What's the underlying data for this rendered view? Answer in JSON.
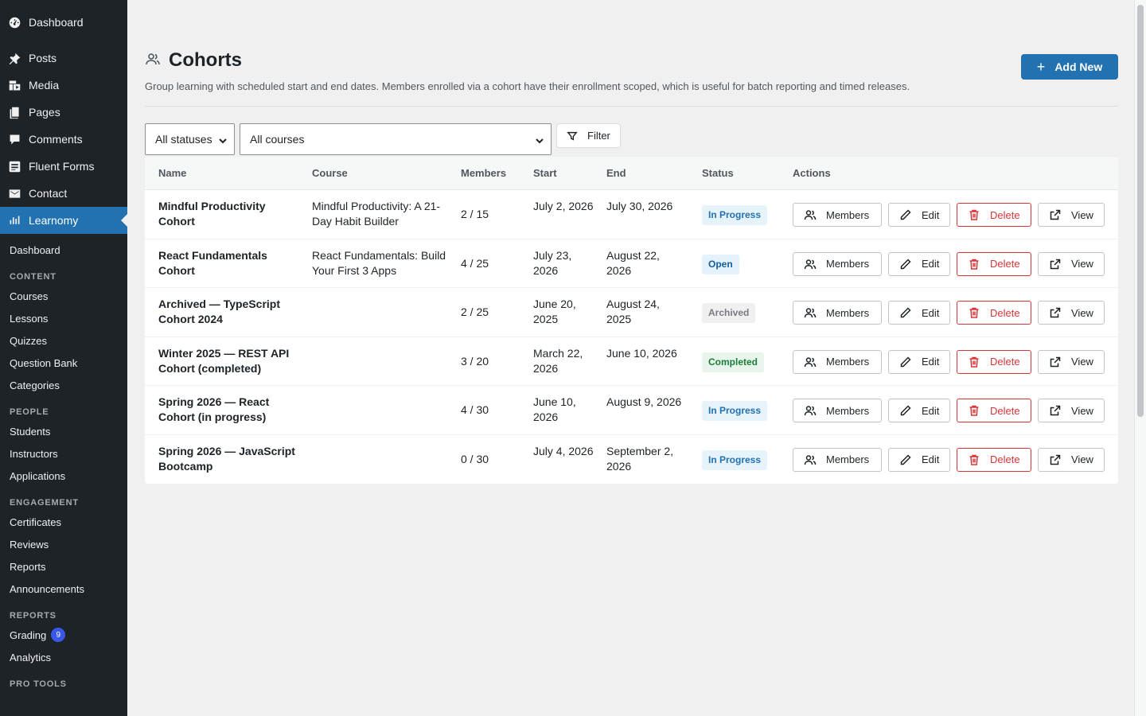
{
  "sidebar": {
    "main_items": [
      {
        "label": "Dashboard",
        "icon": "dashboard-icon"
      },
      {
        "label": "Posts",
        "icon": "pin-icon"
      },
      {
        "label": "Media",
        "icon": "media-icon"
      },
      {
        "label": "Pages",
        "icon": "pages-icon"
      },
      {
        "label": "Comments",
        "icon": "comment-icon"
      },
      {
        "label": "Fluent Forms",
        "icon": "forms-icon"
      },
      {
        "label": "Contact",
        "icon": "mail-icon"
      },
      {
        "label": "Learnomy",
        "icon": "chart-icon",
        "active": true
      }
    ],
    "sub": {
      "dashboard": "Dashboard",
      "content_head": "CONTENT",
      "content": [
        "Courses",
        "Lessons",
        "Quizzes",
        "Question Bank",
        "Categories"
      ],
      "people_head": "PEOPLE",
      "people": [
        "Students",
        "Instructors",
        "Applications"
      ],
      "engagement_head": "ENGAGEMENT",
      "engagement": [
        "Certificates",
        "Reviews",
        "Reports",
        "Announcements"
      ],
      "reports_head": "REPORTS",
      "grading": "Grading",
      "grading_badge": "9",
      "analytics": "Analytics",
      "pro_head": "PRO TOOLS"
    }
  },
  "header": {
    "title": "Cohorts",
    "description": "Group learning with scheduled start and end dates. Members enrolled via a cohort have their enrollment scoped, which is useful for batch reporting and timed releases.",
    "add_new": "Add New"
  },
  "filters": {
    "status": "All statuses",
    "course": "All courses",
    "filter_button": "Filter"
  },
  "table": {
    "columns": [
      "Name",
      "Course",
      "Members",
      "Start",
      "End",
      "Status",
      "Actions"
    ],
    "action_labels": {
      "members": "Members",
      "edit": "Edit",
      "delete": "Delete",
      "view": "View"
    },
    "rows": [
      {
        "name": "Mindful Productivity Cohort",
        "course": "Mindful Productivity: A 21-Day Habit Builder",
        "members": "2 / 15",
        "start": "July 2, 2026",
        "end": "July 30, 2026",
        "status": "In Progress"
      },
      {
        "name": "React Fundamentals Cohort",
        "course": "React Fundamentals: Build Your First 3 Apps",
        "members": "4 / 25",
        "start": "July 23, 2026",
        "end": "August 22, 2026",
        "status": "Open"
      },
      {
        "name": "Archived — TypeScript Cohort 2024",
        "course": "",
        "members": "2 / 25",
        "start": "June 20, 2025",
        "end": "August 24, 2025",
        "status": "Archived"
      },
      {
        "name": "Winter 2025 — REST API Cohort (completed)",
        "course": "",
        "members": "3 / 20",
        "start": "March 22, 2026",
        "end": "June 10, 2026",
        "status": "Completed"
      },
      {
        "name": "Spring 2026 — React Cohort (in progress)",
        "course": "",
        "members": "4 / 30",
        "start": "June 10, 2026",
        "end": "August 9, 2026",
        "status": "In Progress"
      },
      {
        "name": "Spring 2026 — JavaScript Bootcamp",
        "course": "",
        "members": "0 / 30",
        "start": "July 4, 2026",
        "end": "September 2, 2026",
        "status": "In Progress"
      }
    ]
  },
  "status_colors": {
    "In Progress": {
      "bg": "#e7f3fb",
      "fg": "#2271b1"
    },
    "Open": {
      "bg": "#e5f1fb",
      "fg": "#135e96"
    },
    "Archived": {
      "bg": "#f0f0f1",
      "fg": "#787c82"
    },
    "Completed": {
      "bg": "#e8f5ec",
      "fg": "#1a7f37"
    }
  },
  "accent": "#2271b1"
}
